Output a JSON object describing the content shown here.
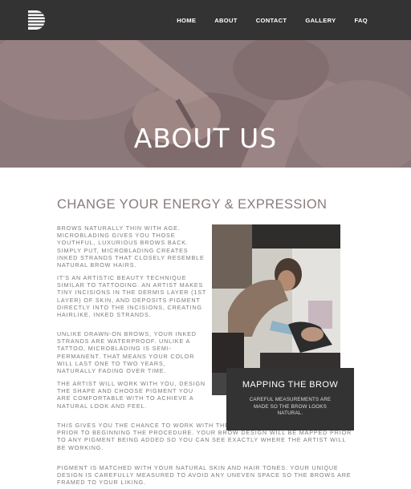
{
  "nav": {
    "logo_icon": "striped-d-logo-icon",
    "items": [
      {
        "label": "HOME"
      },
      {
        "label": "ABOUT"
      },
      {
        "label": "CONTACT"
      },
      {
        "label": "GALLERY"
      },
      {
        "label": "FAQ"
      }
    ]
  },
  "hero": {
    "title": "ABOUT US"
  },
  "section": {
    "heading": "CHANGE YOUR ENERGY & EXPRESSION",
    "paragraphs": [
      "BROWS NATURALLY THIN WITH AGE. MICROBLADING GIVES YOU THOSE YOUTHFUL, LUXURIOUS BROWS BACK. SIMPLY PUT, MICROBLADING CREATES INKED STRANDS THAT CLOSELY RESEMBLE NATURAL BROW HAIRS.",
      "IT'S AN ARTISTIC BEAUTY TECHNIQUE SIMILAR TO TATTOOING. AN ARTIST MAKES TINY INCISIONS IN THE DERMIS LAYER (1ST LAYER) OF SKIN, AND DEPOSITS PIGMENT DIRECTLY INTO THE INCISIONS, CREATING HAIRLIKE, INKED STRANDS.",
      "UNLIKE DRAWN-ON BROWS, YOUR INKED STRANDS ARE WATERPROOF. UNLIKE A TATTOO, MICROBLADING IS SEMI-PERMANENT. THAT MEANS YOUR COLOR WILL LAST ONE TO TWO YEARS, NATURALLY FADING OVER TIME.",
      "THE ARTIST WILL WORK WITH YOU, DESIGN THE SHAPE AND CHOOSE PIGMENT YOU ARE COMFORTABLE WITH TO ACHIEVE A NATURAL LOOK AND FEEL.",
      "THIS GIVES YOU THE CHANCE TO WORK WITH THE ARTIST AND APPROVE ALL WORK PRIOR TO BEGINNING THE PROCEDURE. YOUR BROW DESIGN WILL BE MAPPED PRIOR TO ANY PIGMENT BEING ADDED SO YOU CAN SEE EXACTLY WHERE THE ARTIST WILL BE WORKING.",
      "PIGMENT IS MATCHED WITH YOUR NATURAL SKIN AND HAIR TONES. YOUR UNIQUE DESIGN IS CAREFULLY MEASURED TO AVOID ANY UNEVEN SPACE SO THE BROWS ARE FRAMED TO YOUR LIKING."
    ]
  },
  "card": {
    "title": "MAPPING THE BROW",
    "text": "CAREFUL MEASUREMENTS ARE MADE SO THE BROW LOOKS NATURAL."
  },
  "colors": {
    "nav_bg": "#333333",
    "hero_tint": "#8a7678",
    "heading": "#8a7a7b",
    "card_bg": "#333333"
  }
}
